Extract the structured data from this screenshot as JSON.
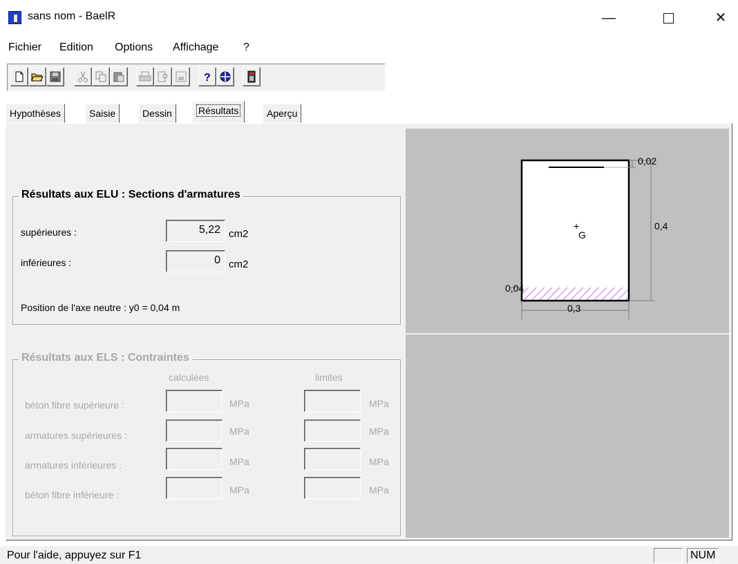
{
  "window": {
    "title": "sans nom - BaelR"
  },
  "menu": [
    "Fichier",
    "Edition",
    "Options",
    "Affichage",
    "?"
  ],
  "toolbar_icons": [
    "new-file-icon",
    "open-folder-icon",
    "save-icon",
    "cut-icon",
    "copy-icon",
    "paste-icon",
    "print-icon",
    "print-preview-icon",
    "print-setup-icon",
    "help-icon",
    "context-help-icon",
    "calculator-icon"
  ],
  "tabs": [
    "Hypothèses",
    "Saisie",
    "Dessin",
    "Résultats",
    "Aperçu"
  ],
  "active_tab": "Résultats",
  "elu": {
    "title": "Résultats aux ELU : Sections d'armatures",
    "sup_label": "supérieures :",
    "sup_value": "5,22",
    "sup_unit": "cm2",
    "inf_label": "inférieures :",
    "inf_value": "0",
    "inf_unit": "cm2",
    "axe_neutre": "Position de l'axe neutre : y0 = 0,04 m"
  },
  "els": {
    "title": "Résultats aux ELS : Contraintes",
    "col_calc": "calculées",
    "col_lim": "limites",
    "unit": "MPa",
    "rows": [
      "béton fibre supérieure :",
      "armatures supérieures :",
      "armatures inférieures :",
      "béton fibre inférieure :"
    ]
  },
  "drawing": {
    "top_cover": "0,02",
    "height": "0,4",
    "bottom_cover": "0,04",
    "width": "0,3",
    "centroid": "G"
  },
  "status": {
    "help": "Pour l'aide, appuyez sur F1",
    "num": "NUM"
  }
}
